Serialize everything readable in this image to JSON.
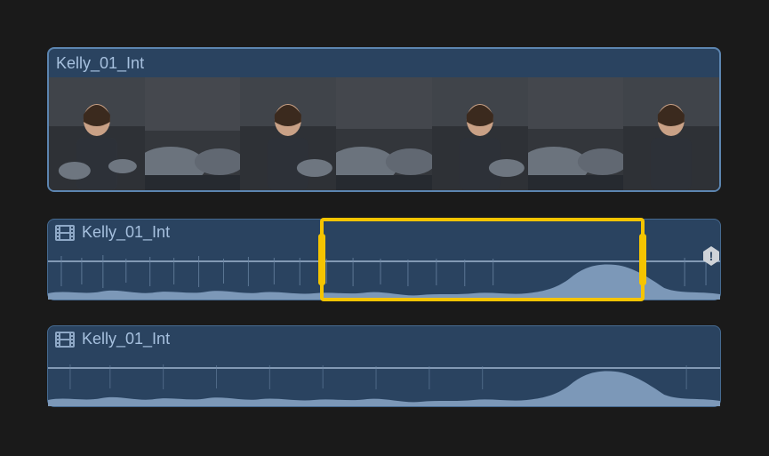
{
  "clips": [
    {
      "name": "Kelly_01_Int",
      "type": "video-filmstrip",
      "frames": 7
    },
    {
      "name": "Kelly_01_Int",
      "type": "audio",
      "range_selection": {
        "left_pct": 40.5,
        "width_pct": 48.3
      },
      "marker_pct": 97.5
    },
    {
      "name": "Kelly_01_Int",
      "type": "audio"
    }
  ],
  "colors": {
    "selection": "#f5c400",
    "clip_bg": "#2a4360",
    "clip_border": "#5c85b0",
    "text": "#a6c0de",
    "waveform": "#7c98b8"
  }
}
